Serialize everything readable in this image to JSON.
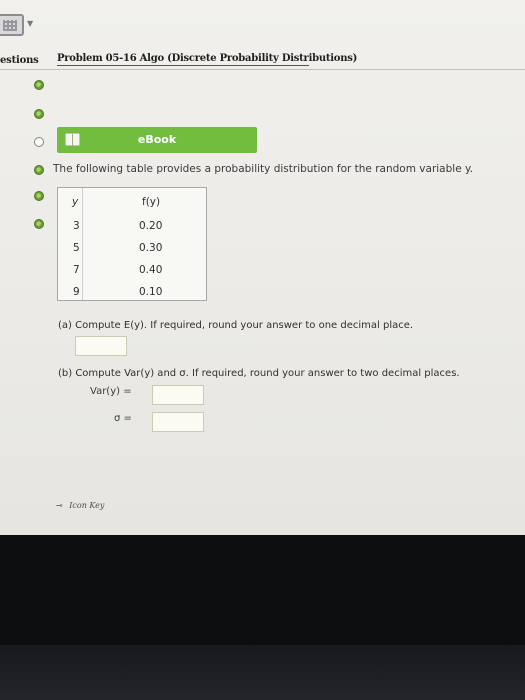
{
  "header": {
    "questions_label": "estions",
    "problem_title": "Problem 05-16 Algo (Discrete Probability Distributions)"
  },
  "ebook": {
    "label": "eBook"
  },
  "intro": "The following table provides a probability distribution for the random variable y.",
  "table": {
    "columns": [
      "y",
      "f(y)"
    ],
    "rows": [
      {
        "y": "3",
        "fy": "0.20"
      },
      {
        "y": "5",
        "fy": "0.30"
      },
      {
        "y": "7",
        "fy": "0.40"
      },
      {
        "y": "9",
        "fy": "0.10"
      }
    ]
  },
  "part_a": {
    "text": "(a) Compute E(y). If required, round your answer to one decimal place."
  },
  "part_b": {
    "text": "(b) Compute Var(y) and σ. If required, round your answer to two decimal places.",
    "var_label": "Var(y) =",
    "sigma_label": "σ ="
  },
  "footer": {
    "icon_key": "Icon Key"
  },
  "icons": {
    "grid_icon": "grid-icon",
    "book_icon": "book-icon",
    "status_icons": [
      "check-circle-icon",
      "check-circle-icon",
      "circle-icon",
      "check-circle-icon",
      "check-circle-icon",
      "check-circle-icon"
    ]
  }
}
